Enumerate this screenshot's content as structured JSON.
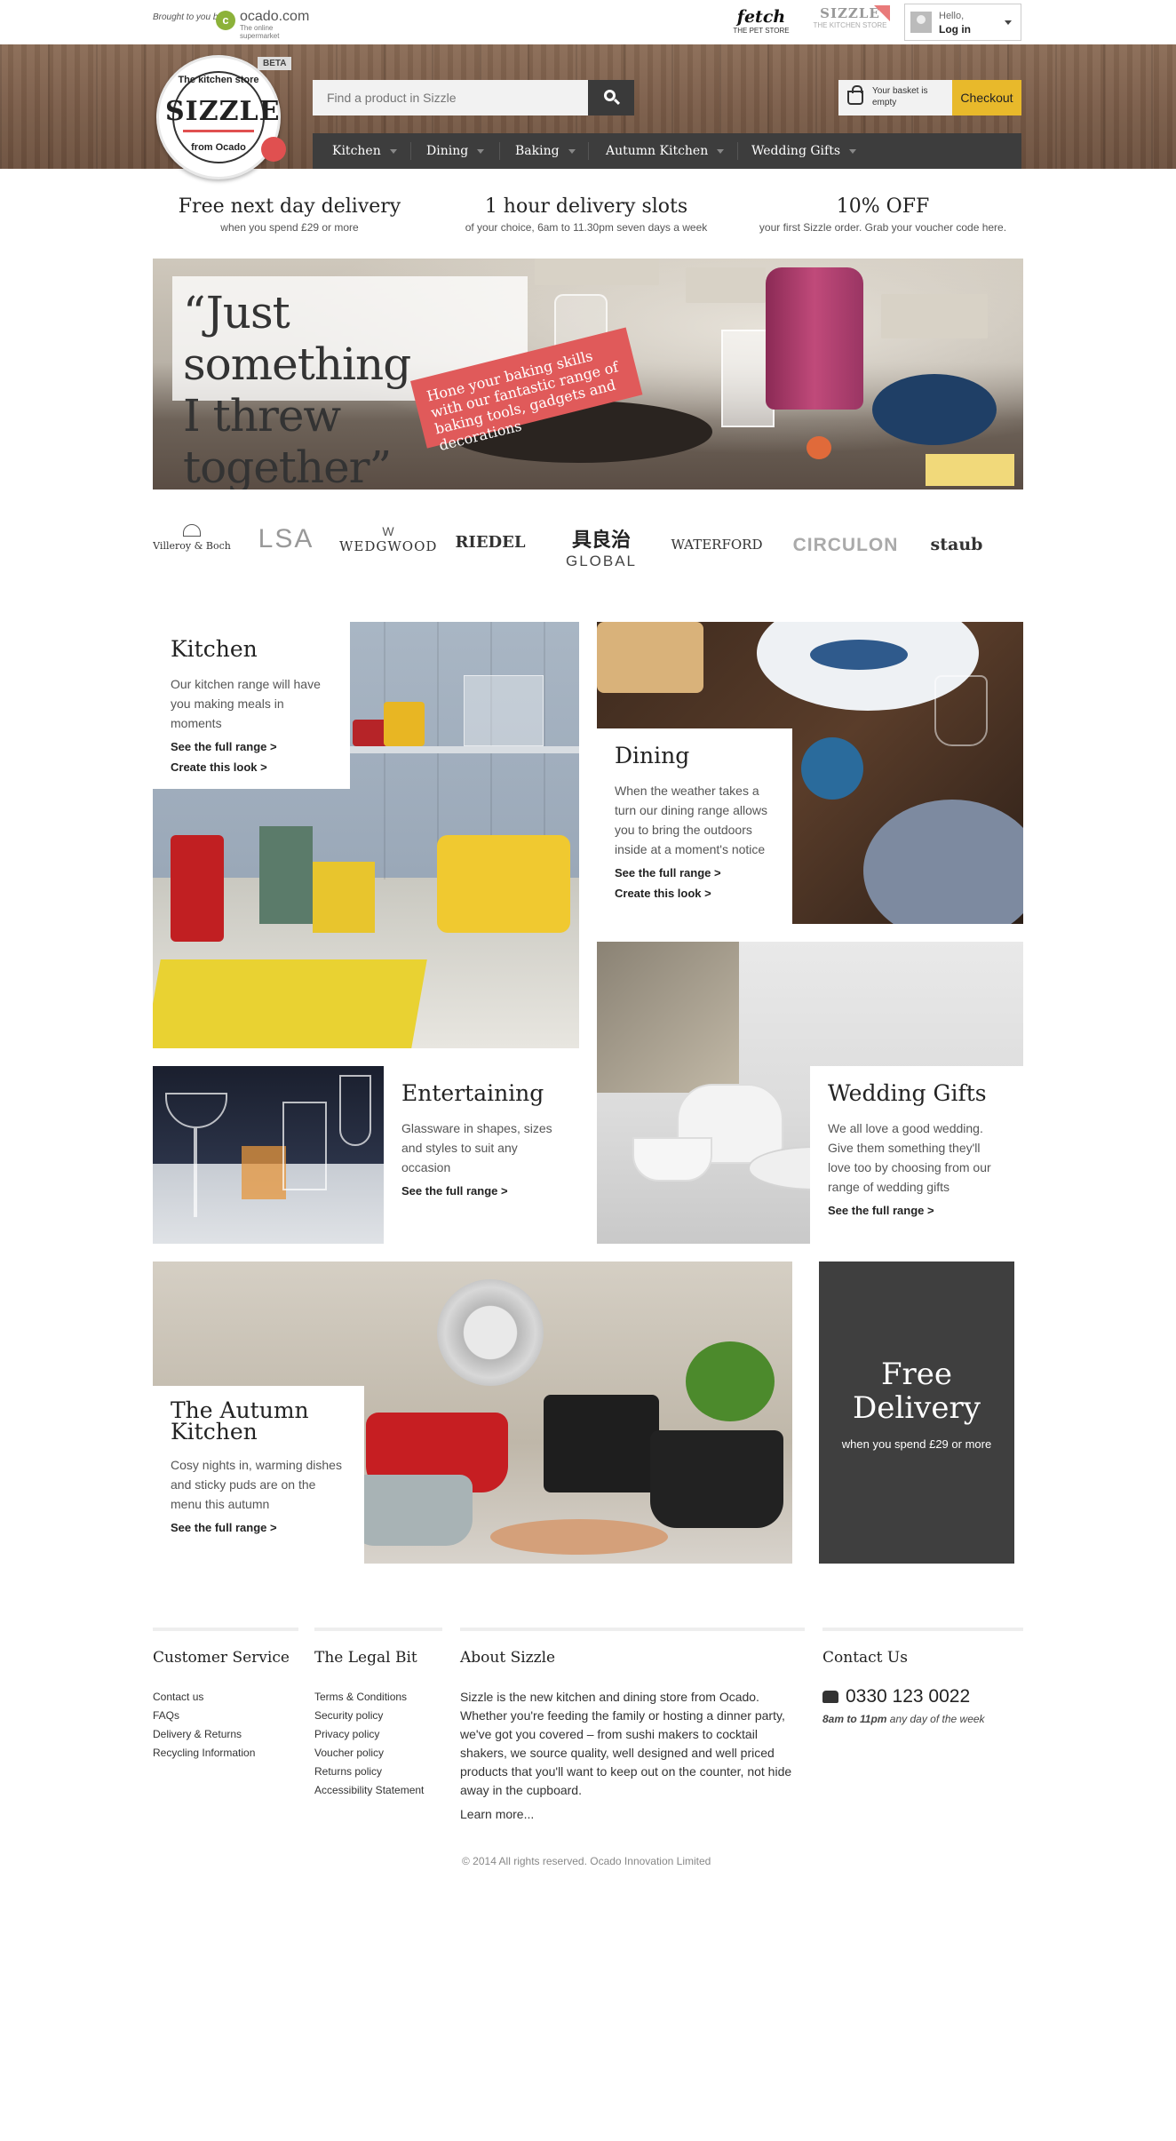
{
  "topbar": {
    "brought_by": "Brought to you by",
    "ocado": {
      "name": "ocado.com",
      "tagline": "The online supermarket"
    },
    "fetch": {
      "name": "fetch",
      "sub": "THE PET STORE"
    },
    "sizzle_tab": {
      "name": "SIZZLE",
      "sub": "THE KITCHEN STORE"
    },
    "login": {
      "hello": "Hello,",
      "action": "Log in"
    }
  },
  "header": {
    "logo": {
      "top": "The kitchen store",
      "word": "SIZZLE",
      "bottom": "from Ocado",
      "beta": "BETA"
    },
    "search_placeholder": "Find a product in Sizzle",
    "basket_text": "Your basket is empty",
    "checkout": "Checkout",
    "nav": [
      "Kitchen",
      "Dining",
      "Baking",
      "Autumn Kitchen",
      "Wedding Gifts"
    ]
  },
  "usps": [
    {
      "title": "Free next day delivery",
      "sub": "when you spend £29 or more"
    },
    {
      "title": "1 hour delivery slots",
      "sub": "of your choice, 6am to 11.30pm seven days a week"
    },
    {
      "title": "10% OFF",
      "sub": "your first Sizzle order. Grab your voucher code here."
    }
  ],
  "hero": {
    "quote_line1": "“Just something",
    "quote_line2": "I threw together”",
    "tag": "Hone your baking skills with our fantastic range of baking tools, gadgets and decorations"
  },
  "brands": [
    "Villeroy & Boch",
    "LSA",
    "WEDGWOOD",
    "RIEDEL",
    "GLOBAL",
    "WATERFORD",
    "CIRCULON",
    "staub"
  ],
  "tiles": {
    "kitchen": {
      "title": "Kitchen",
      "body": "Our kitchen range will have you making meals in moments",
      "link1": "See the full range >",
      "link2": "Create this look >"
    },
    "dining": {
      "title": "Dining",
      "body": "When the weather takes a turn our dining range allows you to bring the outdoors inside at a moment's notice",
      "link1": "See the full range >",
      "link2": "Create this look >"
    },
    "entertaining": {
      "title": "Entertaining",
      "body": "Glassware in shapes, sizes and styles to suit any occasion",
      "link1": "See the full range >"
    },
    "wedding": {
      "title": "Wedding Gifts",
      "body": "We all love a good wedding. Give them something they'll love too by choosing from our range of wedding gifts",
      "link1": "See the full range >"
    },
    "autumn": {
      "title": "The Autumn Kitchen",
      "body": "Cosy nights in, warming dishes and sticky puds are on the menu this autumn",
      "link1": "See the full range >"
    },
    "free_delivery": {
      "title": "Free Delivery",
      "sub": "when you spend £29 or more"
    }
  },
  "footer": {
    "customer_service": {
      "title": "Customer Service",
      "links": [
        "Contact us",
        "FAQs",
        "Delivery & Returns",
        "Recycling Information"
      ]
    },
    "legal": {
      "title": "The Legal Bit",
      "links": [
        "Terms & Conditions",
        "Security policy",
        "Privacy policy",
        "Voucher policy",
        "Returns policy",
        "Accessibility Statement"
      ]
    },
    "about": {
      "title": "About Sizzle",
      "text": "Sizzle is the new kitchen and dining store from Ocado. Whether you're feeding the family or hosting a dinner party, we've got you covered – from sushi makers to cocktail shakers, we source quality, well designed and well priced products that you'll want to keep out on the counter, not hide away in the cupboard.",
      "more": "Learn more..."
    },
    "contact": {
      "title": "Contact Us",
      "phone": "0330 123 0022",
      "hours_bold": "8am to 11pm",
      "hours_rest": " any day of the week"
    },
    "copyright": "© 2014 All rights reserved. Ocado Innovation Limited"
  },
  "colors": {
    "accent_yellow": "#e8b92b",
    "accent_red": "#e05a5a",
    "dark_grey": "#3f3f3f",
    "ocado_green": "#8cb23a"
  }
}
